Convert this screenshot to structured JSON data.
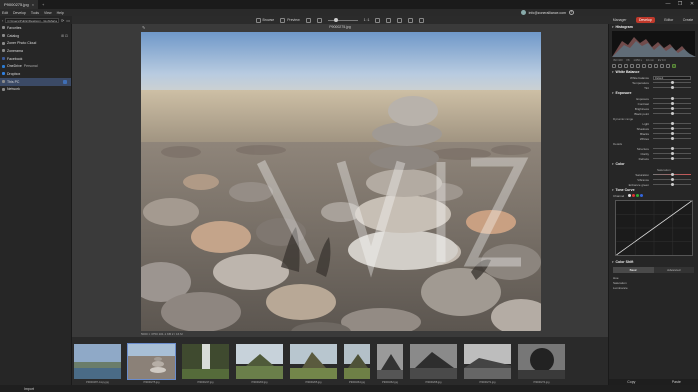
{
  "window": {
    "tab_title": "P9000275.jpg",
    "minimize": "—",
    "maximize": "❐",
    "close": "✕"
  },
  "menu": [
    "Edit",
    "Develop",
    "Tools",
    "View",
    "Help"
  ],
  "account": {
    "email": "info@zoneralliance.com",
    "help": "?"
  },
  "path": {
    "value": "C:\\Users\\Public\\Desktop\\...\\Hoi\\Marta Pd",
    "placeholder": ""
  },
  "toolbar": {
    "browse": "Browse",
    "preview": "Preview",
    "zoom": "1 :1"
  },
  "modes": [
    "Manager",
    "Develop",
    "Editor",
    "Create"
  ],
  "sidebar": {
    "items": [
      {
        "label": "Favorites",
        "sub": ""
      },
      {
        "label": "Catalog",
        "sub": ""
      },
      {
        "label": "Zoner Photo Cloud",
        "sub": ""
      },
      {
        "label": "Zonerama",
        "sub": ""
      },
      {
        "label": "Facebook",
        "sub": ""
      },
      {
        "label": "OneDrive",
        "sub": "Personal"
      },
      {
        "label": "Dropbox",
        "sub": ""
      },
      {
        "label": "This PC",
        "sub": ""
      },
      {
        "label": "Network",
        "sub": ""
      }
    ]
  },
  "viewer": {
    "filename": "P9000275.jpg",
    "info": "5000 × 3750   101.1 KB   2 / 16 M"
  },
  "filmstrip": [
    {
      "caption": "P9000287-Copy.jpg",
      "kind": "lake"
    },
    {
      "caption": "P9000275.jpg",
      "kind": "stones"
    },
    {
      "caption": "P9000247.jpg",
      "kind": "waterfall"
    },
    {
      "caption": "P9000260.jpg",
      "kind": "island"
    },
    {
      "caption": "P9000265.jpg",
      "kind": "castle"
    },
    {
      "caption": "P9000264.jpg",
      "kind": "castle2"
    },
    {
      "caption": "P9000262.jpg",
      "kind": "bw"
    },
    {
      "caption": "P9000268.jpg",
      "kind": "bw2"
    },
    {
      "caption": "P9000271.jpg",
      "kind": "bw3"
    },
    {
      "caption": "P9000274.jpg",
      "kind": "bw4"
    }
  ],
  "status": {
    "import": "Import"
  },
  "panel": {
    "histogram": "Histogram",
    "histo_info": [
      "ISO 100",
      "f/8",
      "1/250 s",
      "10 mm",
      "EV 0.0"
    ],
    "white_balance": {
      "title": "White Balance",
      "mode_label": "White balance",
      "mode_value": "Default",
      "rows": [
        "Temperature",
        "Tint"
      ]
    },
    "exposure": {
      "title": "Exposure",
      "rows": [
        "Exposure",
        "Contrast",
        "Brightness",
        "Black point"
      ],
      "dynamic_range": "Dynamic range",
      "dr_rows": [
        "Light",
        "Shadows",
        "Blacks",
        "Whites"
      ],
      "details": "Details",
      "detail_rows": [
        "Structure",
        "Clarity",
        "Dehaze"
      ]
    },
    "color": {
      "title": "Color",
      "saturation_label": "Saturation",
      "rows": [
        "Saturation",
        "Vibrance",
        "Enhance green"
      ]
    },
    "tone_curve": {
      "title": "Tone Curve",
      "channel": "Channel"
    },
    "color_shift": {
      "title": "Color Shift",
      "modes": [
        "Basic",
        "Advanced"
      ],
      "rows": [
        "Hue",
        "Saturation",
        "Luminance"
      ]
    },
    "copy": "Copy",
    "paste": "Paste"
  },
  "colors": {
    "accent": "#c0392b",
    "selection": "#3b4a66",
    "panel": "#262626"
  }
}
